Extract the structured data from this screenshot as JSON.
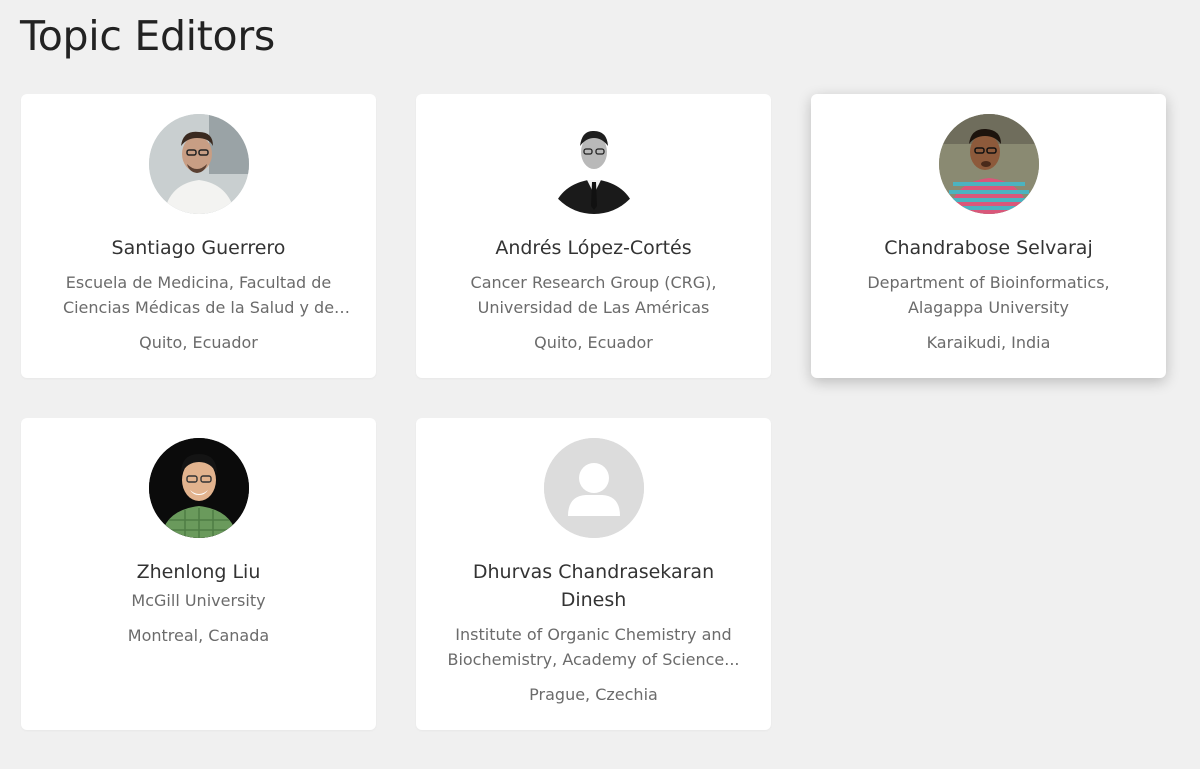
{
  "page": {
    "title": "Topic Editors"
  },
  "editors": [
    {
      "name": "Santiago Guerrero",
      "affiliation": "Escuela de Medicina, Facultad de Ciencias Médicas de la Salud y de l...",
      "location": "Quito, Ecuador"
    },
    {
      "name": "Andrés López-Cortés",
      "affiliation": "Cancer Research Group (CRG), Universidad de Las Américas",
      "location": "Quito, Ecuador"
    },
    {
      "name": "Chandrabose Selvaraj",
      "affiliation": "Department of Bioinformatics, Alagappa University",
      "location": "Karaikudi, India"
    },
    {
      "name": "Zhenlong Liu",
      "affiliation": "McGill University",
      "location": "Montreal, Canada"
    },
    {
      "name": "Dhurvas Chandrasekaran Dinesh",
      "affiliation": "Institute of Organic Chemistry and Biochemistry, Academy of Science...",
      "location": "Prague, Czechia"
    }
  ]
}
